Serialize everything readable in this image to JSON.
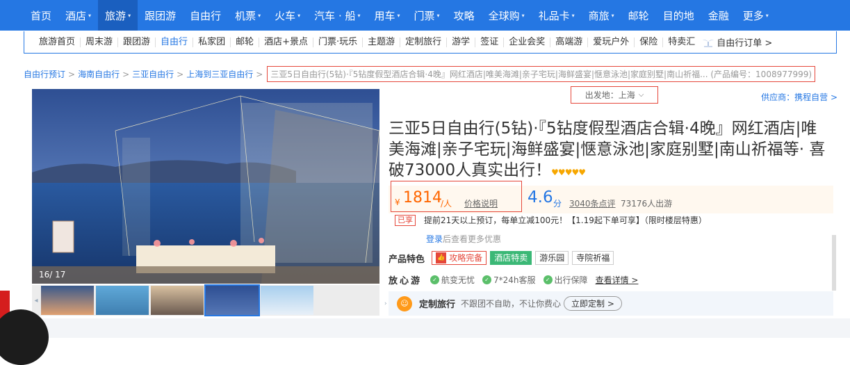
{
  "topnav": {
    "items": [
      {
        "label": "首页",
        "caret": ""
      },
      {
        "label": "酒店",
        "caret": "▾"
      },
      {
        "label": "旅游",
        "caret": "▾"
      },
      {
        "label": "跟团游",
        "caret": ""
      },
      {
        "label": "自由行",
        "caret": ""
      },
      {
        "label": "机票",
        "caret": "▾"
      },
      {
        "label": "火车",
        "caret": "▾"
      },
      {
        "label": "汽车 · 船",
        "caret": "▾"
      },
      {
        "label": "用车",
        "caret": "▾"
      },
      {
        "label": "门票",
        "caret": "▾"
      },
      {
        "label": "攻略",
        "caret": ""
      },
      {
        "label": "全球购",
        "caret": "▾"
      },
      {
        "label": "礼品卡",
        "caret": "▾"
      },
      {
        "label": "商旅",
        "caret": "▾"
      },
      {
        "label": "邮轮",
        "caret": ""
      },
      {
        "label": "目的地",
        "caret": ""
      },
      {
        "label": "金融",
        "caret": ""
      },
      {
        "label": "更多",
        "caret": "▾"
      }
    ]
  },
  "subnav": {
    "items": [
      "旅游首页",
      "周末游",
      "跟团游",
      "自由行",
      "私家团",
      "邮轮",
      "酒店+景点",
      "门票·玩乐",
      "主题游",
      "定制旅行",
      "游学",
      "签证",
      "企业会奖",
      "高端游",
      "爱玩户外",
      "保险",
      "特卖汇"
    ],
    "order": "自由行订单 >"
  },
  "breadcrumb": {
    "items": [
      "自由行预订",
      "海南自由行",
      "三亚自由行",
      "上海到三亚自由行"
    ],
    "current": "三亚5日自由行(5钻)·『5钻度假型酒店合辑·4晚』网红酒店|唯美海滩|亲子宅玩|海鲜盛宴|惬意泳池|家庭别墅|南山祈福... (产品编号：1008977999)"
  },
  "departure": "出发地：上海",
  "supplier": "供应商：携程自营 >",
  "gallery": {
    "counter": "16/ 17"
  },
  "product": {
    "title": "三亚5日自由行(5钻)·『5钻度假型酒店合辑·4晚』网红酒店|唯美海滩|亲子宅玩|海鲜盛宴|惬意泳池|家庭别墅|南山祈福等· 喜破73000人真实出行！",
    "hearts": "♥♥♥♥♥",
    "currency": "¥",
    "price": "1814",
    "price_unit": "/人",
    "price_link": "价格说明",
    "score": "4.6",
    "score_unit": "分",
    "reviews": "3040条点评",
    "travelers": "73176人出游",
    "promo_tag": "已享",
    "promo_text": "提前21天以上预订，每单立减100元！【1.19起下单可享】（限时楼层特惠）",
    "login_link": "登录",
    "login_text": "后查看更多优惠"
  },
  "features": {
    "label": "产品特色",
    "tags": [
      "攻略完备",
      "酒店特卖",
      "游乐园",
      "寺院祈福"
    ],
    "tag_icon": "👍"
  },
  "worry_free": {
    "label": "放心游",
    "items": [
      "航变无忧",
      "7*24h客服",
      "出行保障"
    ],
    "link": "查看详情 >"
  },
  "custom_tour": {
    "name": "定制旅行",
    "desc": "不跟团不自助，不让你费心",
    "button": "立即定制 >"
  },
  "colors": {
    "primary": "#2577e3",
    "accent": "#ff6600",
    "highlight": "#e5473a",
    "green": "#3bb876"
  }
}
